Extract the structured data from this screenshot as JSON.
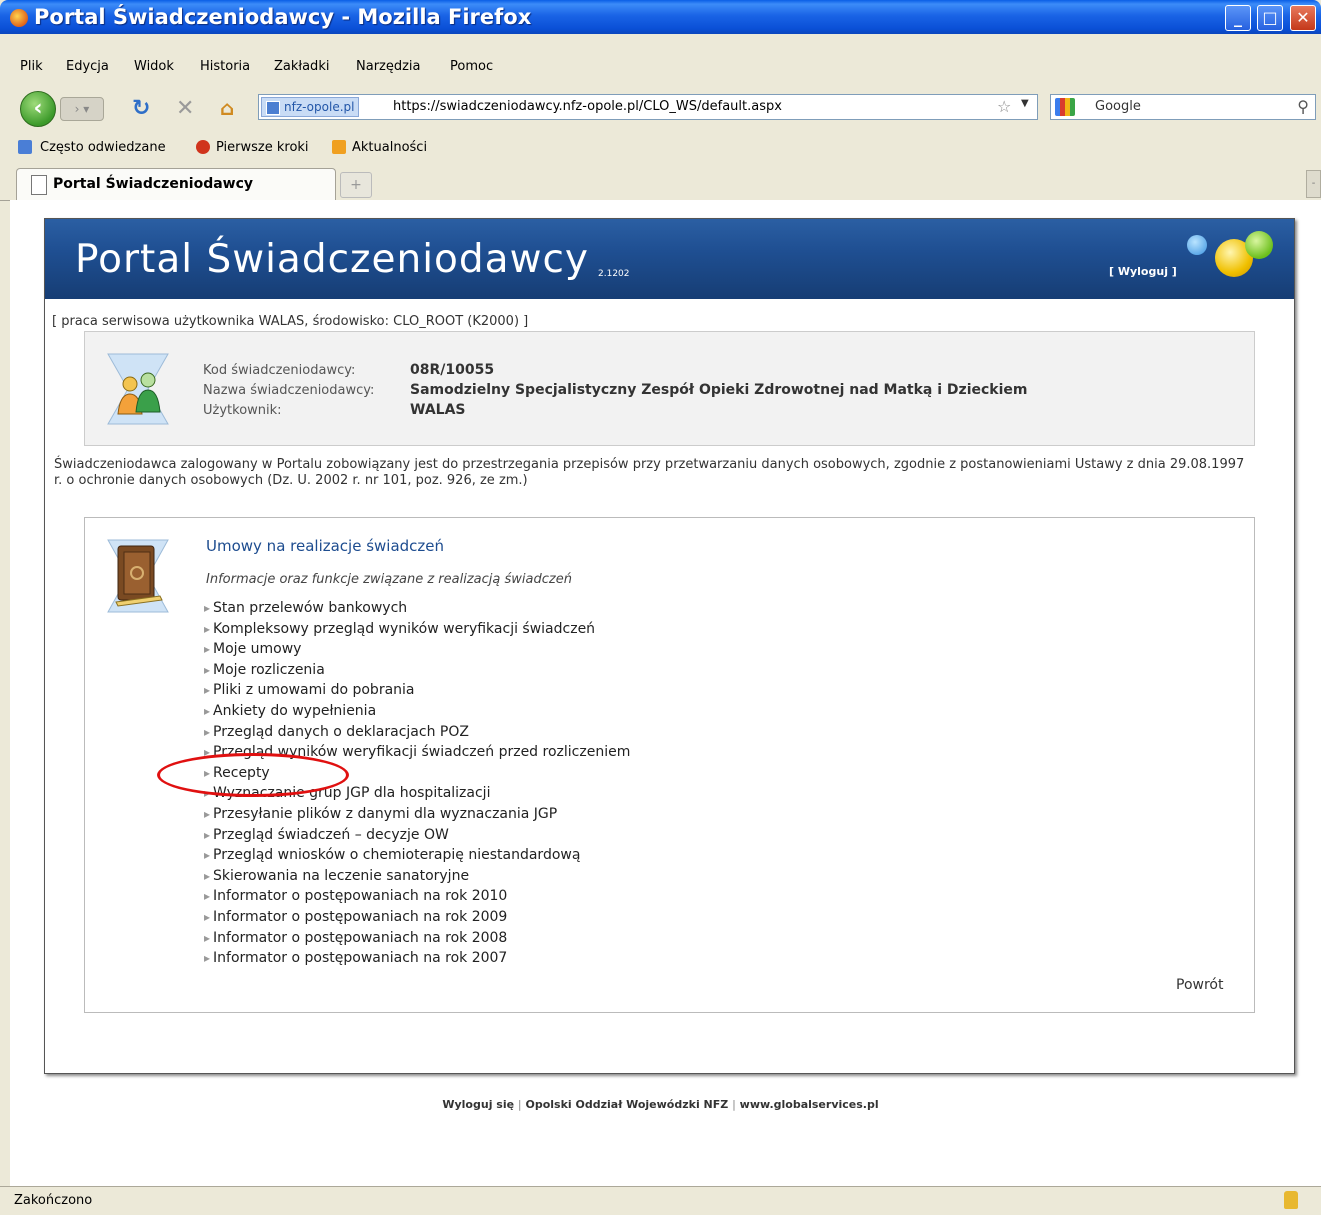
{
  "window": {
    "title": "Portal Świadczeniodawcy - Mozilla Firefox",
    "btn_min": "_",
    "btn_max": "□",
    "btn_close": "✕"
  },
  "menu": [
    "Plik",
    "Edycja",
    "Widok",
    "Historia",
    "Zakładki",
    "Narzędzia",
    "Pomoc"
  ],
  "nav": {
    "site_badge": "nfz-opole.pl",
    "url": "https://swiadczeniodawcy.nfz-opole.pl/CLO_WS/default.aspx",
    "search_placeholder": "Google"
  },
  "bookmarks": [
    "Często odwiedzane",
    "Pierwsze kroki",
    "Aktualności"
  ],
  "tab": {
    "label": "Portal Świadczeniodawcy",
    "new_tab": "+"
  },
  "portal": {
    "title": "Portal Świadczeniodawcy",
    "version": "2.1202",
    "logout": "[ Wyloguj ]",
    "session": "[ praca serwisowa użytkownika WALAS, środowisko: CLO_ROOT (K2000) ]",
    "info": {
      "code_label": "Kod świadczeniodawcy:",
      "code_value": "08R/10055",
      "name_label": "Nazwa świadczeniodawcy:",
      "name_value": "Samodzielny Specjalistyczny Zespół Opieki Zdrowotnej nad Matką i Dzieckiem",
      "user_label": "Użytkownik:",
      "user_value": "WALAS"
    },
    "notice": "Świadczeniodawca zalogowany w Portalu zobowiązany jest do przestrzegania przepisów przy przetwarzaniu danych osobowych, zgodnie z postanowieniami Ustawy z dnia 29.08.1997 r. o ochronie danych osobowych (Dz. U. 2002 r. nr 101, poz. 926, ze zm.)",
    "section": {
      "title": "Umowy na realizacje świadczeń",
      "subtitle": "Informacje oraz funkcje związane z realizacją świadczeń",
      "links": [
        "Stan przelewów bankowych",
        "Kompleksowy przegląd wyników weryfikacji świadczeń",
        "Moje umowy",
        "Moje rozliczenia",
        "Pliki z umowami do pobrania",
        "Ankiety do wypełnienia",
        "Przegląd danych o deklaracjach POZ",
        "Przegląd wyników weryfikacji świadczeń przed rozliczeniem",
        "Recepty",
        "Wyznaczanie grup JGP dla hospitalizacji",
        "Przesyłanie plików z danymi dla wyznaczania JGP",
        "Przegląd świadczeń – decyzje OW",
        "Przegląd wniosków o chemioterapię niestandardową",
        "Skierowania na leczenie sanatoryjne",
        "Informator o postępowaniach na rok 2010",
        "Informator o postępowaniach na rok 2009",
        "Informator o postępowaniach na rok 2008",
        "Informator o postępowaniach na rok 2007"
      ],
      "back": "Powrót"
    },
    "footer": {
      "logout": "Wyloguj się",
      "sep": "|",
      "branch": "Opolski Oddział Wojewódzki NFZ",
      "site": "www.globalservices.pl"
    }
  },
  "status": "Zakończono",
  "colors": {
    "banner": "#1f4f92",
    "highlight_circle": "#e01010",
    "title_link": "#1d4c8f"
  }
}
